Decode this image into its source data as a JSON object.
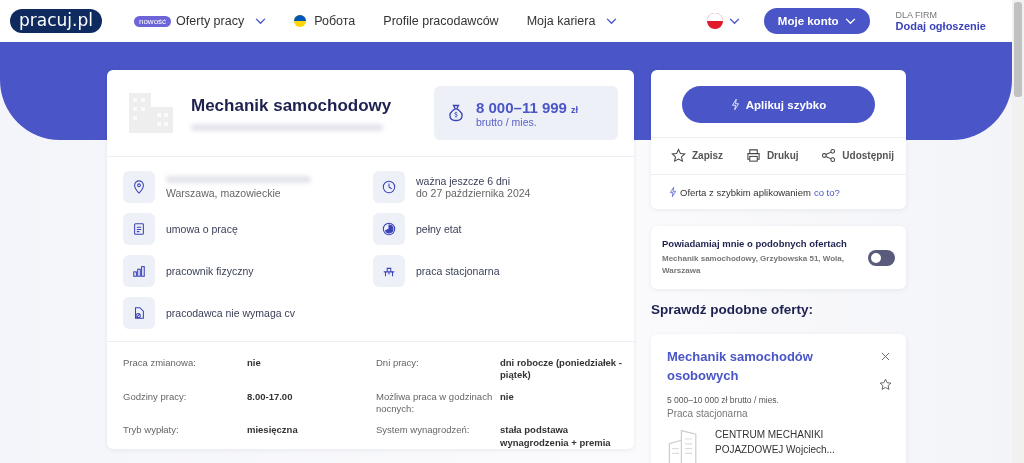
{
  "header": {
    "logo": "pracuj.pl",
    "nav": [
      {
        "badge": "nowość",
        "label": "Oferty pracy",
        "kind": "dropdown"
      },
      {
        "label": "Робота",
        "kind": "flag"
      },
      {
        "label": "Profile pracodawców",
        "kind": "link"
      },
      {
        "label": "Moja kariera",
        "kind": "dropdown"
      }
    ],
    "account_button": "Moje konto",
    "firms_label": "DLA FIRM",
    "firms_link": "Dodaj ogłoszenie"
  },
  "job": {
    "title": "Mechanik samochodowy",
    "salary": "8 000–11 999",
    "currency": "zł",
    "salary_note": "brutto / mies.",
    "features": [
      {
        "kind": "location",
        "lines": [
          "Warszawa, mazowieckie"
        ]
      },
      {
        "kind": "contract",
        "lines": [
          "umowa o pracę"
        ]
      },
      {
        "kind": "chart",
        "lines": [
          "pracownik fizyczny"
        ]
      },
      {
        "kind": "nocv",
        "lines": [
          "pracodawca nie wymaga cv"
        ]
      },
      {
        "kind": "clock",
        "lines": [
          "ważna jeszcze 6 dni",
          "do 27 października 2024"
        ]
      },
      {
        "kind": "time",
        "lines": [
          "pełny etat"
        ]
      },
      {
        "kind": "desk",
        "lines": [
          "praca stacjonarna"
        ]
      }
    ],
    "details": [
      {
        "label": "Praca zmianowa:",
        "value": "nie"
      },
      {
        "label": "Dni pracy:",
        "value": "dni robocze (poniedziałek - piątek)"
      },
      {
        "label": "Godziny pracy:",
        "value": "8.00-17.00"
      },
      {
        "label": "Możliwa praca w godzinach nocnych:",
        "value": "nie"
      },
      {
        "label": "Tryb wypłaty:",
        "value": "miesięczna"
      },
      {
        "label": "System wynagrodzeń:",
        "value": "stała podstawa wynagrodzenia + premia"
      }
    ]
  },
  "apply": {
    "button": "Aplikuj szybko",
    "actions": [
      {
        "kind": "star",
        "label": "Zapisz"
      },
      {
        "kind": "print",
        "label": "Drukuj"
      },
      {
        "kind": "share",
        "label": "Udostępnij"
      }
    ],
    "note": "Oferta z szybkim aplikowaniem",
    "note_link": "co to?"
  },
  "alert": {
    "title": "Powiadamiaj mnie o podobnych ofertach",
    "subtitle": "Mechanik samochodowy, Grzybowska 51, Wola, Warszawa",
    "on": false
  },
  "similar": {
    "heading": "Sprawdź podobne oferty:",
    "offers": [
      {
        "title": "Mechanik samochodów osobowych",
        "salary": "5 000–10 000 zł brutto / mies.",
        "mode": "Praca stacjonarna",
        "company": "CENTRUM MECHANIKI POJAZDOWEJ Wojciech..."
      }
    ]
  }
}
